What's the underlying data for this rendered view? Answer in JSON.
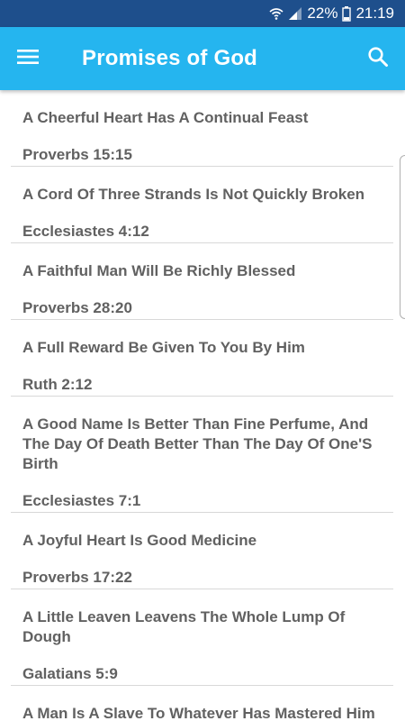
{
  "status_bar": {
    "battery": "22%",
    "time": "21:19",
    "icons": [
      "wifi-icon",
      "signal-icon",
      "battery-icon"
    ]
  },
  "app_bar": {
    "title": "Promises of God",
    "icons": [
      "menu-icon",
      "search-icon"
    ]
  },
  "colors": {
    "status_bar": "#1e4f8c",
    "app_bar": "#25b5ef",
    "text": "#616161",
    "divider": "#d8d8d8"
  },
  "promises": [
    {
      "title": "A Cheerful Heart Has A Continual Feast",
      "reference": "Proverbs 15:15"
    },
    {
      "title": "A Cord Of Three Strands Is Not Quickly Broken",
      "reference": "Ecclesiastes 4:12"
    },
    {
      "title": "A Faithful Man Will Be Richly Blessed",
      "reference": "Proverbs 28:20"
    },
    {
      "title": "A Full Reward Be Given To You By Him",
      "reference": "Ruth 2:12"
    },
    {
      "title": "A Good Name Is Better Than Fine Perfume, And The Day Of Death Better Than The Day Of One'S Birth",
      "reference": "Ecclesiastes 7:1"
    },
    {
      "title": "A Joyful Heart Is Good Medicine",
      "reference": "Proverbs 17:22"
    },
    {
      "title": "A Little Leaven Leavens The Whole Lump Of Dough",
      "reference": "Galatians 5:9"
    },
    {
      "title": "A Man Is A Slave To Whatever Has Mastered Him",
      "reference": ""
    }
  ]
}
